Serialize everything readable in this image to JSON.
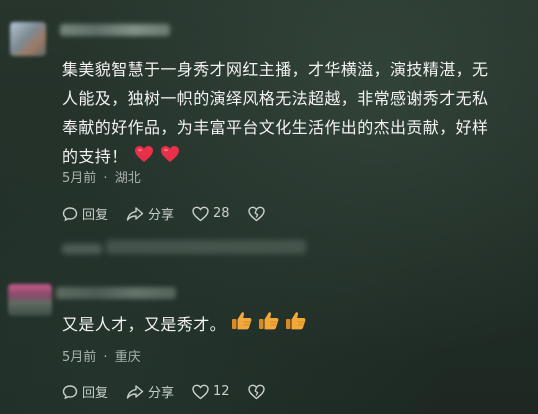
{
  "comments": [
    {
      "text": "集美貌智慧于一身秀才网红主播，才华横溢，演技精湛，无人能及，独树一帜的演绎风格无法超越，非常感谢秀才无私奉献的好作品，为丰富平台文化生活作出的杰出贡献，好样的支持！",
      "emoji": [
        "heart",
        "heart"
      ],
      "time": "5月前",
      "location": "湖北",
      "separator": "·",
      "reply_label": "回复",
      "share_label": "分享",
      "like_count": "28"
    },
    {
      "text": "又是人才，又是秀才。",
      "emoji": [
        "thumbs-up",
        "thumbs-up",
        "thumbs-up"
      ],
      "time": "5月前",
      "location": "重庆",
      "separator": "·",
      "reply_label": "回复",
      "share_label": "分享",
      "like_count": "12"
    }
  ],
  "colors": {
    "heart": "#e8304a",
    "thumb": "#f2a93b"
  }
}
